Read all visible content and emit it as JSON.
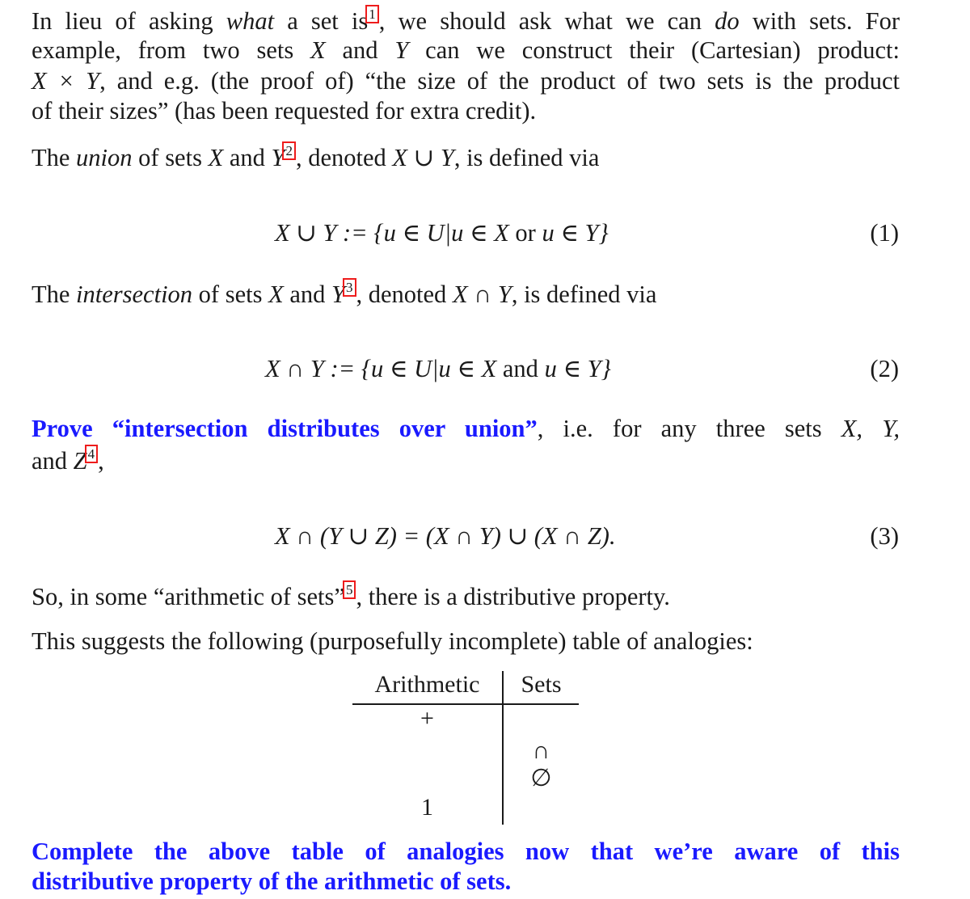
{
  "paragraphs": {
    "p1": {
      "l1_a": "In lieu of asking ",
      "l1_em": "what",
      "l1_b": " a set is",
      "fn": "1",
      "l1_c": ", we should ask what we can ",
      "l1_em2": "do",
      "l1_d": " with sets. For",
      "l2_a": "example, from two sets ",
      "l2_X": "X",
      "l2_b": " and ",
      "l2_Y": "Y",
      "l2_c": " can we construct their (Cartesian) product:",
      "l3_a": "X × Y",
      "l3_b": ", and e.g. (the proof of) “the size of the product of two sets is the product",
      "l4": "of their sizes” (has been requested for extra credit)."
    },
    "p2": {
      "a": "The ",
      "em": "union",
      "b": " of sets ",
      "X": "X",
      "c": " and ",
      "Y": "Y",
      "fn": "2",
      "d": ", denoted ",
      "sym": "X ∪ Y",
      "e": ", is defined via"
    },
    "eq1": {
      "body_a": "X ∪ Y := {u ∈ U|u ∈ X ",
      "word": "or",
      "body_b": " u ∈ Y}",
      "num": "(1)"
    },
    "p3": {
      "a": "The ",
      "em": "intersection",
      "b": " of sets ",
      "X": "X",
      "c": " and ",
      "Y": "Y",
      "fn": "3",
      "d": ", denoted ",
      "sym": "X ∩ Y",
      "e": ", is defined via"
    },
    "eq2": {
      "body_a": "X ∩ Y := {u ∈ U|u ∈ X ",
      "word": "and",
      "body_b": " u ∈ Y}",
      "num": "(2)"
    },
    "p4": {
      "blue": "Prove “intersection distributes over union”",
      "a": ", i.e. for any three sets ",
      "sets": "X, Y,",
      "l2_a": "and ",
      "Z": "Z",
      "fn": "4",
      "l2_b": ","
    },
    "eq3": {
      "body": "X ∩ (Y ∪ Z) = (X ∩ Y) ∪ (X ∩ Z).",
      "num": "(3)"
    },
    "p5": {
      "a": "So, in some “arithmetic of sets”",
      "fn": "5",
      "b": ", there is a distributive property."
    },
    "p6": "This suggests the following (purposefully incomplete) table of analogies:",
    "p7": {
      "l1": "Complete the above table of analogies now that we’re aware of this",
      "l2": "distributive property of the arithmetic of sets."
    }
  },
  "table": {
    "headers": [
      "Arithmetic",
      "Sets"
    ],
    "rows": [
      [
        "+",
        ""
      ],
      [
        "",
        "∩"
      ],
      [
        "",
        "∅"
      ],
      [
        "1",
        ""
      ]
    ]
  },
  "colors": {
    "accent_blue": "#1a1aff",
    "footnote_box": "#ee1c1c",
    "text": "#1a1a1a"
  }
}
